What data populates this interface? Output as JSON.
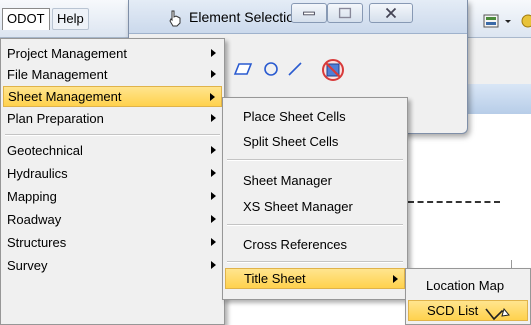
{
  "menubar": {
    "odot_label": "ODOT",
    "help_label": "Help"
  },
  "element_window": {
    "title": "Element Selection"
  },
  "odot_menu": {
    "items": [
      {
        "label": "Project Management"
      },
      {
        "label": "File Management"
      },
      {
        "label": "Sheet Management"
      },
      {
        "label": "Plan Preparation"
      },
      {
        "label": "Geotechnical"
      },
      {
        "label": "Hydraulics"
      },
      {
        "label": "Mapping"
      },
      {
        "label": "Roadway"
      },
      {
        "label": "Structures"
      },
      {
        "label": "Survey"
      }
    ]
  },
  "sheet_menu": {
    "items": [
      {
        "label": "Place Sheet Cells"
      },
      {
        "label": "Split Sheet Cells"
      },
      {
        "label": "Sheet Manager"
      },
      {
        "label": "XS Sheet Manager"
      },
      {
        "label": "Cross References"
      },
      {
        "label": "Title Sheet"
      }
    ]
  },
  "title_menu": {
    "items": [
      {
        "label": "Location Map"
      },
      {
        "label": "SCD List"
      }
    ]
  },
  "colors": {
    "highlight": "#ffd24d",
    "menu_bg": "#f0f0f0"
  }
}
